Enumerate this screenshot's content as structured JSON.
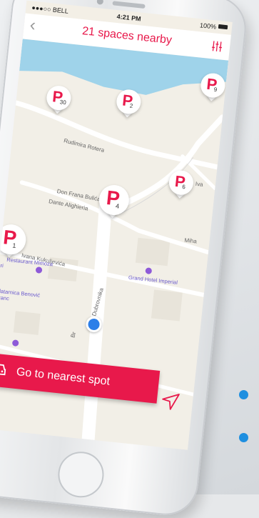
{
  "status": {
    "carrier": "●●●○○ BELL",
    "time": "4:21 PM",
    "battery": "100%"
  },
  "nav": {
    "title": "21 spaces nearby"
  },
  "map": {
    "pins": [
      {
        "num": "9"
      },
      {
        "num": "30"
      },
      {
        "num": "2"
      },
      {
        "num": "6"
      },
      {
        "num": "4"
      },
      {
        "num": "1"
      }
    ],
    "streets": [
      "Rudimira Rotera",
      "Don Frana Bulića",
      "Dante Alighieria",
      "Ivana Kukuljevića",
      "Iva",
      "Miha",
      "Ante Dubrovnika"
    ],
    "street_prefix": "Br",
    "pois": [
      "Restaurant Mimoza",
      "Grand Hotel Imperial",
      "Zlatarnica Benović Franc",
      "ari"
    ]
  },
  "cta": {
    "label": "Go to nearest spot"
  },
  "colors": {
    "accent": "#e8194b",
    "blue": "#1e8fe0"
  }
}
